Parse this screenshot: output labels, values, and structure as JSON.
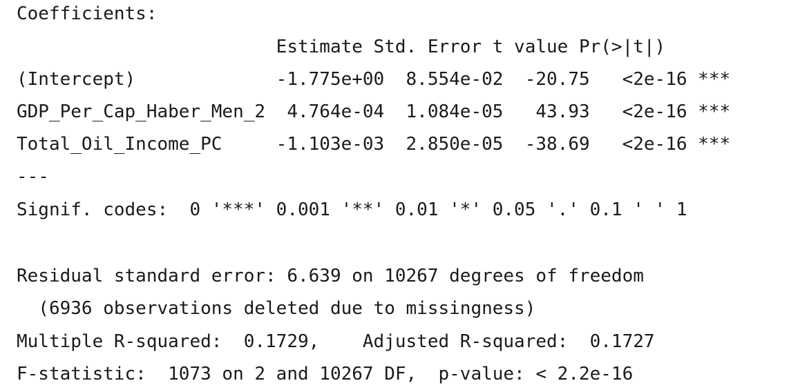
{
  "output": {
    "coefficients_heading": "Coefficients:",
    "column_header": "                        Estimate Std. Error t value Pr(>|t|)",
    "rows": [
      "(Intercept)             -1.775e+00  8.554e-02  -20.75   <2e-16 ***",
      "GDP_Per_Cap_Haber_Men_2  4.764e-04  1.084e-05   43.93   <2e-16 ***",
      "Total_Oil_Income_PC     -1.103e-03  2.850e-05  -38.69   <2e-16 ***"
    ],
    "separator": "---",
    "signif_codes": "Signif. codes:  0 '***' 0.001 '**' 0.01 '*' 0.05 '.' 0.1 ' ' 1",
    "residual_se": "Residual standard error: 6.639 on 10267 degrees of freedom",
    "observations_deleted": "  (6936 observations deleted due to missingness)",
    "r_squared": "Multiple R-squared:  0.1729,    Adjusted R-squared:  0.1727",
    "f_statistic": "F-statistic:  1073 on 2 and 10267 DF,  p-value: < 2.2e-16"
  }
}
